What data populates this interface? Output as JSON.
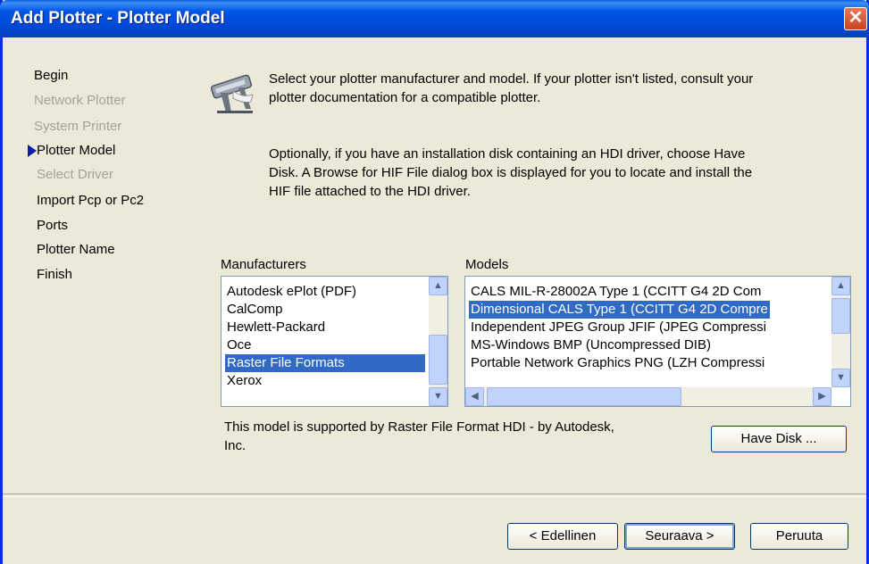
{
  "window": {
    "title": "Add Plotter - Plotter Model",
    "close_glyph": "✕"
  },
  "steps": [
    {
      "label": "Begin",
      "state": "normal"
    },
    {
      "label": "Network Plotter",
      "state": "disabled"
    },
    {
      "label": "System Printer",
      "state": "disabled"
    },
    {
      "label": "Plotter Model",
      "state": "current"
    },
    {
      "label": "Select Driver",
      "state": "disabled"
    },
    {
      "label": "Import Pcp or Pc2",
      "state": "normal"
    },
    {
      "label": "Ports",
      "state": "normal"
    },
    {
      "label": "Plotter Name",
      "state": "normal"
    },
    {
      "label": "Finish",
      "state": "normal"
    }
  ],
  "description": {
    "line1a": "Select your plotter manufacturer and model. If your plotter isn't listed, consult your",
    "line1b": "plotter documentation for a compatible plotter.",
    "line2a": "Optionally, if you have an installation disk containing an HDI driver, choose Have",
    "line2b": "Disk. A Browse for HIF File dialog box is displayed for you to locate and install the",
    "line2c": "HIF file attached to the HDI driver."
  },
  "manufacturers": {
    "label": "Manufacturers",
    "items": [
      "Autodesk ePlot (PDF)",
      "CalComp",
      "Hewlett-Packard",
      "Oce",
      "Raster File Formats",
      "Xerox"
    ],
    "selected_index": 4
  },
  "models": {
    "label": "Models",
    "items": [
      "CALS MIL-R-28002A Type 1 (CCITT G4 2D Com",
      "Dimensional CALS Type 1 (CCITT G4 2D Compre",
      "Independent JPEG Group JFIF (JPEG Compressi",
      "MS-Windows BMP (Uncompressed DIB)",
      "Portable Network Graphics PNG (LZH Compressi"
    ],
    "selected_index": 1
  },
  "support_text_a": "This model is supported by Raster File Format HDI - by Autodesk,",
  "support_text_b": "Inc.",
  "buttons": {
    "have_disk": "Have Disk ...",
    "back": "< Edellinen",
    "next": "Seuraava >",
    "cancel": "Peruuta"
  },
  "colors": {
    "title_blue": "#0055e5",
    "selection": "#316ac5",
    "current_step_arrow": "#0b1ea6"
  }
}
